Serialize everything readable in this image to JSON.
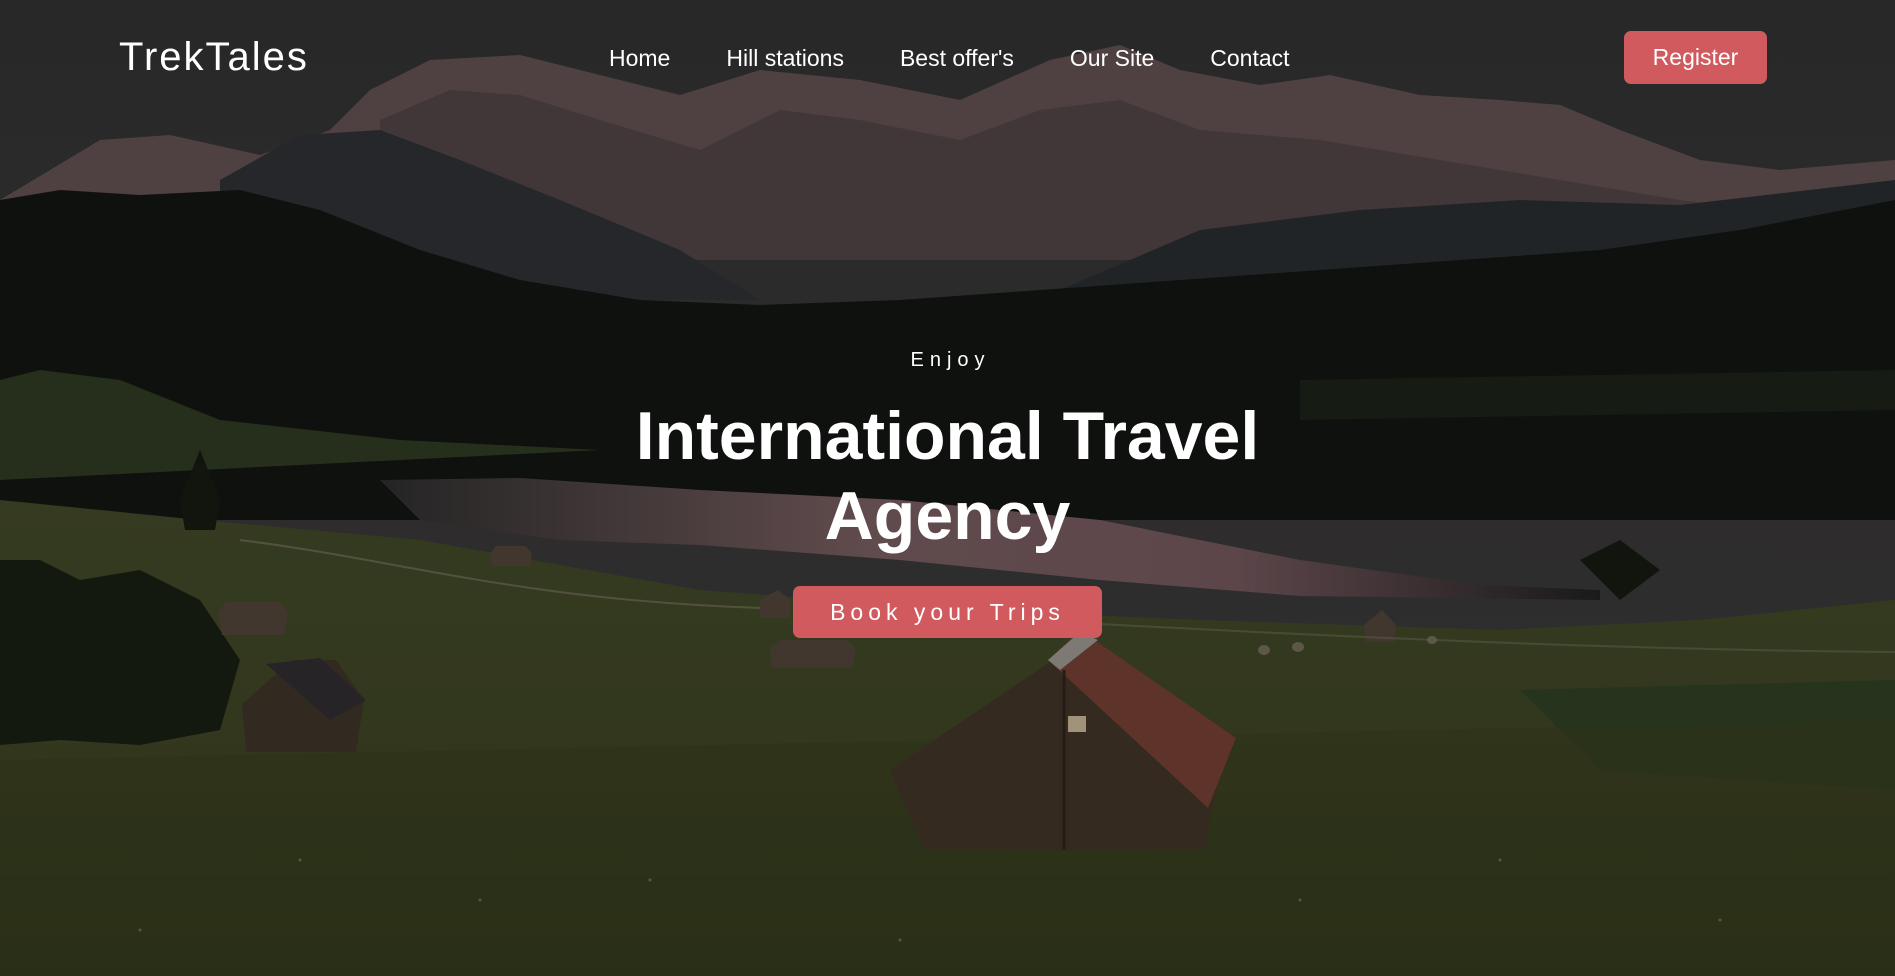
{
  "brand": {
    "name": "TrekTales"
  },
  "nav": {
    "items": [
      {
        "label": "Home"
      },
      {
        "label": "Hill stations"
      },
      {
        "label": "Best offer's"
      },
      {
        "label": "Our Site"
      },
      {
        "label": "Contact"
      }
    ],
    "register_label": "Register"
  },
  "hero": {
    "kicker": "Enjoy",
    "title": "International Travel Agency",
    "cta_label": "Book your Trips"
  },
  "colors": {
    "accent": "#d05a5e",
    "text": "#ffffff"
  },
  "background": {
    "icon": "mountain-valley-photo"
  }
}
